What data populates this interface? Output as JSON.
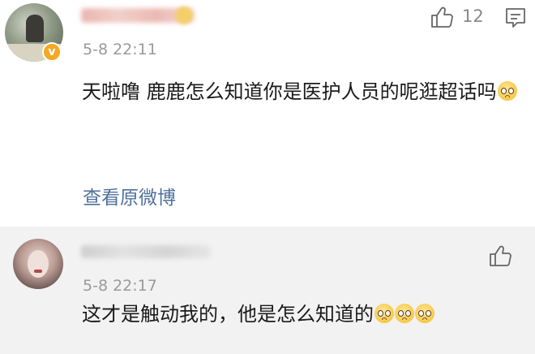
{
  "comments": [
    {
      "username_text": "",
      "timestamp": "5-8 22:11",
      "text": "天啦噜 鹿鹿怎么知道你是医护人员的呢逛超话吗",
      "emoji_count": 1,
      "like_count": "12",
      "view_original_link": "查看原微博",
      "verified_badge": "v"
    },
    {
      "username_text": "",
      "timestamp": "5-8 22:17",
      "text": "这才是触动我的，他是怎么知道的",
      "emoji_count": 3
    }
  ],
  "icons": {
    "like": "thumbs-up-icon",
    "comment": "comment-icon",
    "emoji": "pleading-face-emoji"
  },
  "colors": {
    "link": "#50709b",
    "timestamp": "#9a9a9a",
    "badge": "#f4a923",
    "separator_bg": "#f2f2f2"
  }
}
